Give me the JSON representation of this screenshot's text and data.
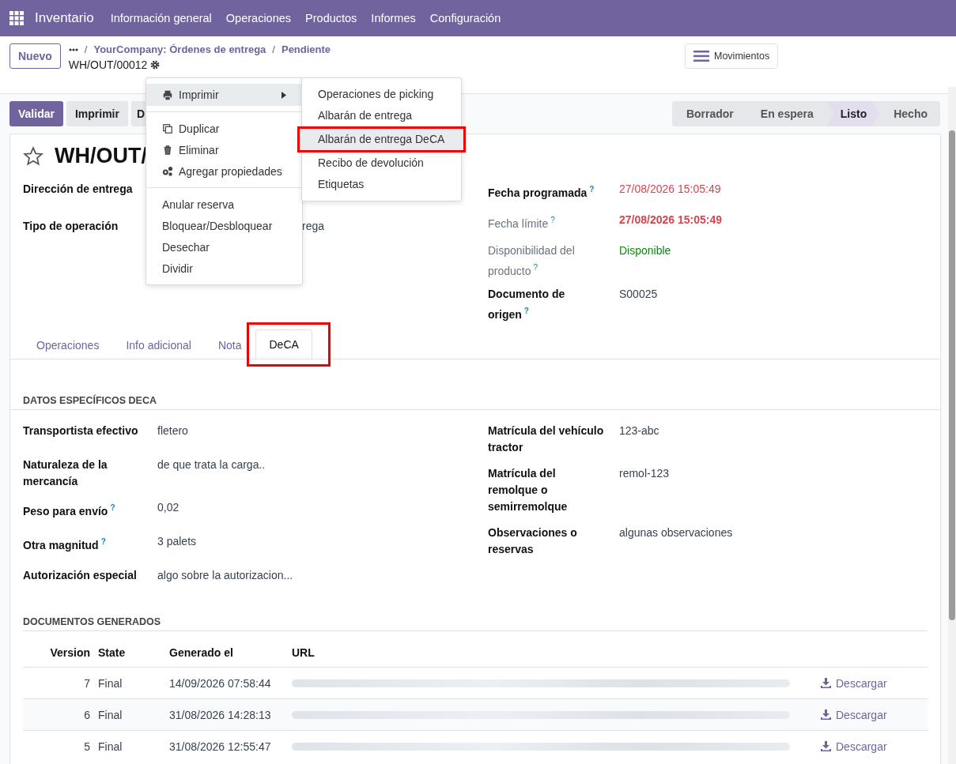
{
  "navbar": {
    "app": "Inventario",
    "menu": [
      "Información general",
      "Operaciones",
      "Productos",
      "Informes",
      "Configuración"
    ]
  },
  "control_panel": {
    "new_button": "Nuevo",
    "separator": "/",
    "breadcrumbs": [
      "YourCompany: Órdenes de entrega",
      "Pendiente"
    ],
    "record": "WH/OUT/00012",
    "moves_button": "Movimientos"
  },
  "actions": [
    {
      "label": "Validar",
      "kind": "primary"
    },
    {
      "label": "Imprimir",
      "kind": "secondary"
    },
    {
      "label": "D",
      "kind": "secondary"
    }
  ],
  "status_steps": [
    {
      "label": "Borrador",
      "selected": false
    },
    {
      "label": "En espera",
      "selected": false
    },
    {
      "label": "Listo",
      "selected": true
    },
    {
      "label": "Hecho",
      "selected": false
    }
  ],
  "title": "WH/OUT/",
  "left_fields": [
    {
      "label": "Dirección de entrega"
    },
    {
      "label": "Tipo de operación",
      "value": "rega"
    }
  ],
  "right_fields": [
    {
      "label": "Fecha programada",
      "help": "?",
      "value": "27/08/2026 15:05:49",
      "muted": false,
      "color": "#d9434e",
      "bold": false
    },
    {
      "label": "Fecha límite",
      "help": "?",
      "value": "27/08/2026 15:05:49",
      "muted": true,
      "color": "#d9434e",
      "bold": true
    },
    {
      "label": "Disponibilidad del producto",
      "help": "?",
      "value": "Disponible",
      "muted": true,
      "color": "#0a8a0a",
      "bold": false
    },
    {
      "label": "Documento de origen",
      "help": "?",
      "value": "S00025",
      "muted": false,
      "bold": false
    }
  ],
  "tabs": [
    {
      "label": "Operaciones",
      "selected": false,
      "highlighted": false
    },
    {
      "label": "Info adicional",
      "selected": false,
      "highlighted": false
    },
    {
      "label": "Nota",
      "selected": false,
      "highlighted": false
    },
    {
      "label": "DeCA",
      "selected": true,
      "highlighted": true
    }
  ],
  "deca": {
    "heading": "DATOS ESPECÍFICOS DECA",
    "left": [
      {
        "label": "Transportista efectivo",
        "value": "fletero"
      },
      {
        "label": "Naturaleza de la mercancía",
        "value": "de que trata la carga.."
      },
      {
        "label": "Peso para envío",
        "help": "?",
        "value": "0,02"
      },
      {
        "label": "Otra magnitud",
        "help": "?",
        "value": "3 palets"
      },
      {
        "label": "Autorización especial",
        "value": "algo sobre la autorizacion..."
      }
    ],
    "right": [
      {
        "label": "Matrícula del vehículo tractor",
        "value": "123-abc"
      },
      {
        "label": "Matrícula del remolque o semirremolque",
        "value": "remol-123"
      },
      {
        "label": "Observaciones o reservas",
        "value": "algunas observaciones"
      }
    ]
  },
  "documents": {
    "heading": "DOCUMENTOS GENERADOS",
    "columns": [
      "Version",
      "State",
      "Generado el",
      "URL"
    ],
    "rows": [
      {
        "version": "7",
        "state": "Final",
        "generated": "14/09/2026 07:58:44",
        "action": "Descargar"
      },
      {
        "version": "6",
        "state": "Final",
        "generated": "31/08/2026 14:28:13",
        "action": "Descargar"
      },
      {
        "version": "5",
        "state": "Final",
        "generated": "31/08/2026 12:55:47",
        "action": "Descargar"
      }
    ]
  },
  "menu": {
    "items": [
      {
        "kind": "submenu",
        "label": "Imprimir",
        "expanded": true
      },
      {
        "kind": "divider"
      },
      {
        "kind": "item",
        "label": "Duplicar"
      },
      {
        "kind": "item",
        "label": "Eliminar"
      },
      {
        "kind": "item",
        "label": "Agregar propiedades"
      },
      {
        "kind": "divider"
      },
      {
        "kind": "item",
        "label": "Anular reserva"
      },
      {
        "kind": "item",
        "label": "Bloquear/Desbloquear"
      },
      {
        "kind": "item",
        "label": "Desechar"
      },
      {
        "kind": "item",
        "label": "Dividir"
      }
    ],
    "submenu": [
      {
        "label": "Operaciones de picking",
        "highlighted": false
      },
      {
        "label": "Albarán de entrega",
        "highlighted": false
      },
      {
        "label": "Albarán de entrega DeCA",
        "highlighted": true
      },
      {
        "label": "Recibo de devolución",
        "highlighted": false
      },
      {
        "label": "Etiquetas",
        "highlighted": false
      }
    ]
  }
}
